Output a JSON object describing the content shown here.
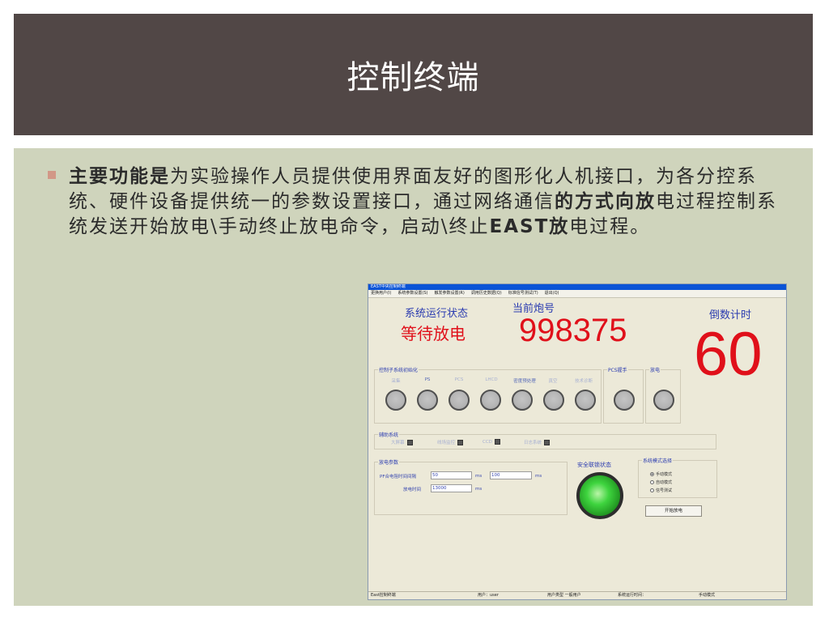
{
  "slide": {
    "title": "控制终端",
    "bullet_bold_1": "主要功能是",
    "bullet_text_1": "为实验操作人员提供使用界面友好的图形化人机接口，为各分控系统、硬件设备提供统一的参数设置接口，通过网络通信",
    "bullet_bold_2": "的方式向放",
    "bullet_text_2": "电过程控制系统发送开始放电\\手动终止放电命令，启动\\终止",
    "bullet_bold_3": "EAST放",
    "bullet_text_3": "电过程。"
  },
  "app": {
    "window_title": "EAST中央控制终端",
    "menu": [
      "更换用户(I)",
      "系统参数设置(S)",
      "触发参数设置(R)",
      "调用历史数据(Q)",
      "标准信号测试(T)",
      "退出(Q)"
    ],
    "status_label": "系统运行状态",
    "status_value": "等待放电",
    "shot_label": "当前炮号",
    "shot_number": "998375",
    "countdown_label": "倒数计时",
    "countdown_value": "60",
    "init_group": {
      "label": "控制子系统初始化",
      "items": [
        "采集",
        "PS",
        "PCS",
        "LHCD",
        "密度预处理",
        "真空",
        "技术诊断"
      ]
    },
    "pcs_group": {
      "label": "PCS握手"
    },
    "discharge_group": {
      "label": "放电"
    },
    "aux_group": {
      "label": "辅助系统",
      "items": [
        "大屏幕",
        "线场监控",
        "CCD",
        "日志系统"
      ]
    },
    "param_group": {
      "label": "放电参数",
      "pf_label": "PF合电阻时间间隔",
      "pf_value_1": "50",
      "pf_unit_1": "ms",
      "pf_value_2": "100",
      "pf_unit_2": "ms",
      "discharge_time_label": "放电时间",
      "discharge_time_value": "13000",
      "discharge_time_unit": "ms"
    },
    "interlock_label": "安全联锁状态",
    "mode_group": {
      "label": "系统模式选择",
      "options": [
        "手动模式",
        "自动模式",
        "信号测试"
      ],
      "selected": 0
    },
    "start_button": "开始放电",
    "statusbar": {
      "app_name": "East控制终端",
      "user": "用户：user",
      "user_type": "用户类型  一般用户",
      "run_time": "系统运行时间：",
      "mode": "手动模式"
    }
  },
  "colors": {
    "title_bg": "#514746",
    "body_bg": "#cfd4bc",
    "bullet": "#d29887",
    "app_blue": "#2a3bb0",
    "app_red": "#e0101a",
    "titlebar_blue": "#0a54d6"
  }
}
